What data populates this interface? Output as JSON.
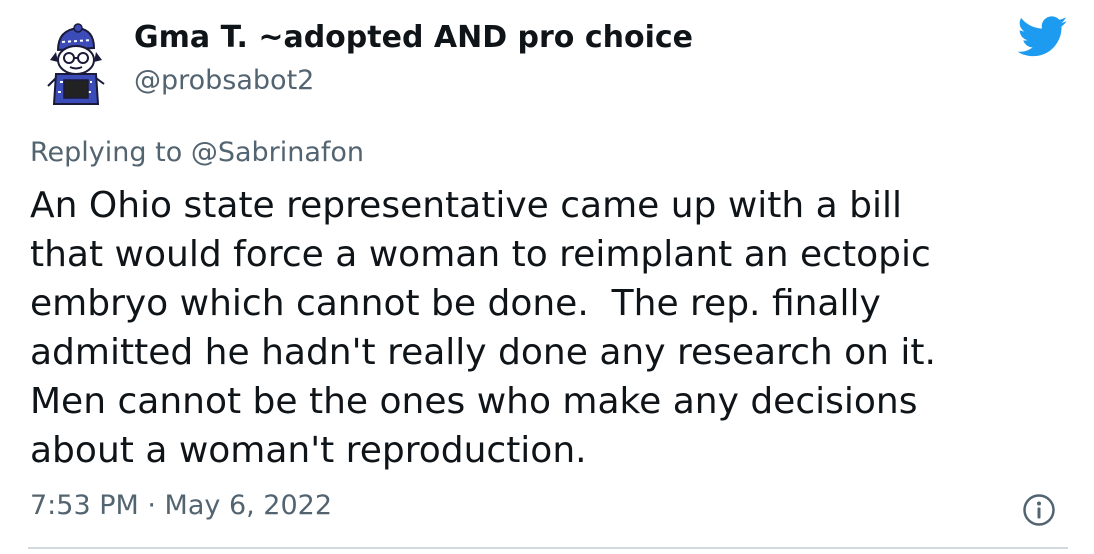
{
  "author": {
    "display_name": "Gma T. ~adopted AND pro choice",
    "handle": "@probsabot2",
    "avatar_icon": "cartoon-character-avatar-icon"
  },
  "logo_icon": "twitter-bird-icon",
  "reply_context": {
    "prefix": "Replying to",
    "mention": "@Sabrinafon"
  },
  "text_lines": [
    "An Ohio state representative came up with a bill",
    "that would force a woman to reimplant an ectopic",
    "embryo which cannot be done.  The rep. finally",
    "admitted he hadn't really done any research on it.",
    "Men cannot be the ones who make any decisions",
    "about a woman't reproduction."
  ],
  "timestamp": "7:53 PM · May 6, 2022",
  "info_icon": "info-circle-icon",
  "colors": {
    "text": "#0f1419",
    "secondary": "#536471",
    "brand_blue": "#1d9bf0",
    "divider": "#cfd9de"
  }
}
